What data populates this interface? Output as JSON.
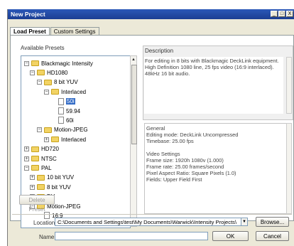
{
  "window": {
    "title": "New Project",
    "controls": [
      "_",
      "□",
      "X"
    ]
  },
  "tabs": [
    {
      "label": "Load Preset"
    },
    {
      "label": "Custom Settings"
    }
  ],
  "presets": {
    "label": "Available Presets",
    "tree": [
      {
        "text": "Blackmagic Intensity",
        "toggle": "−",
        "icon": "folder"
      },
      {
        "text": "HD1080",
        "toggle": "−",
        "icon": "folder"
      },
      {
        "text": "8 bit YUV",
        "toggle": "−",
        "icon": "folder"
      },
      {
        "text": "Interlaced",
        "toggle": "−",
        "icon": "folder"
      },
      {
        "text": "50i",
        "toggle": "",
        "icon": "file",
        "selected": true
      },
      {
        "text": "59.94",
        "toggle": "",
        "icon": "file"
      },
      {
        "text": "60i",
        "toggle": "",
        "icon": "file"
      },
      {
        "text": "Motion-JPEG",
        "toggle": "−",
        "icon": "folder"
      },
      {
        "text": "Interlaced",
        "toggle": "+",
        "icon": "folder"
      },
      {
        "text": "HD720",
        "toggle": "+",
        "icon": "folder"
      },
      {
        "text": "NTSC",
        "toggle": "+",
        "icon": "folder"
      },
      {
        "text": "PAL",
        "toggle": "−",
        "icon": "folder"
      },
      {
        "text": "10 bit YUV",
        "toggle": "+",
        "icon": "folder"
      },
      {
        "text": "8 bit YUV",
        "toggle": "+",
        "icon": "folder"
      },
      {
        "text": "DV",
        "toggle": "+",
        "icon": "folder"
      },
      {
        "text": "Motion-JPEG",
        "toggle": "−",
        "icon": "folder"
      },
      {
        "text": "16:9",
        "toggle": "",
        "icon": "file"
      }
    ]
  },
  "description": {
    "label": "Description",
    "text": "For editing in 8 bits with Blackmagic DeckLink equipment. High Definition 1080 line, 25 fps video (16:9 interlaced). 48kHz 16 bit audio."
  },
  "general": {
    "lines": [
      "General",
      "Editing mode: DeckLink Uncompressed",
      "Timebase: 25.00 fps",
      "",
      "Video Settings",
      "Frame size: 1920h 1080v (1.000)",
      "Frame rate: 25.00 frames/second",
      "Pixel Aspect Ratio: Square Pixels (1.0)",
      "Fields: Upper Field First"
    ]
  },
  "actions": {
    "delete_preset": "Delete Preset",
    "browse": "Browse...",
    "ok": "OK",
    "cancel": "Cancel"
  },
  "location": {
    "label": "Location:",
    "value": "C:\\Documents and Settings\\test\\My Documents\\Warwick\\Intensity Projects\\"
  },
  "name": {
    "label": "Name:",
    "value": ""
  }
}
